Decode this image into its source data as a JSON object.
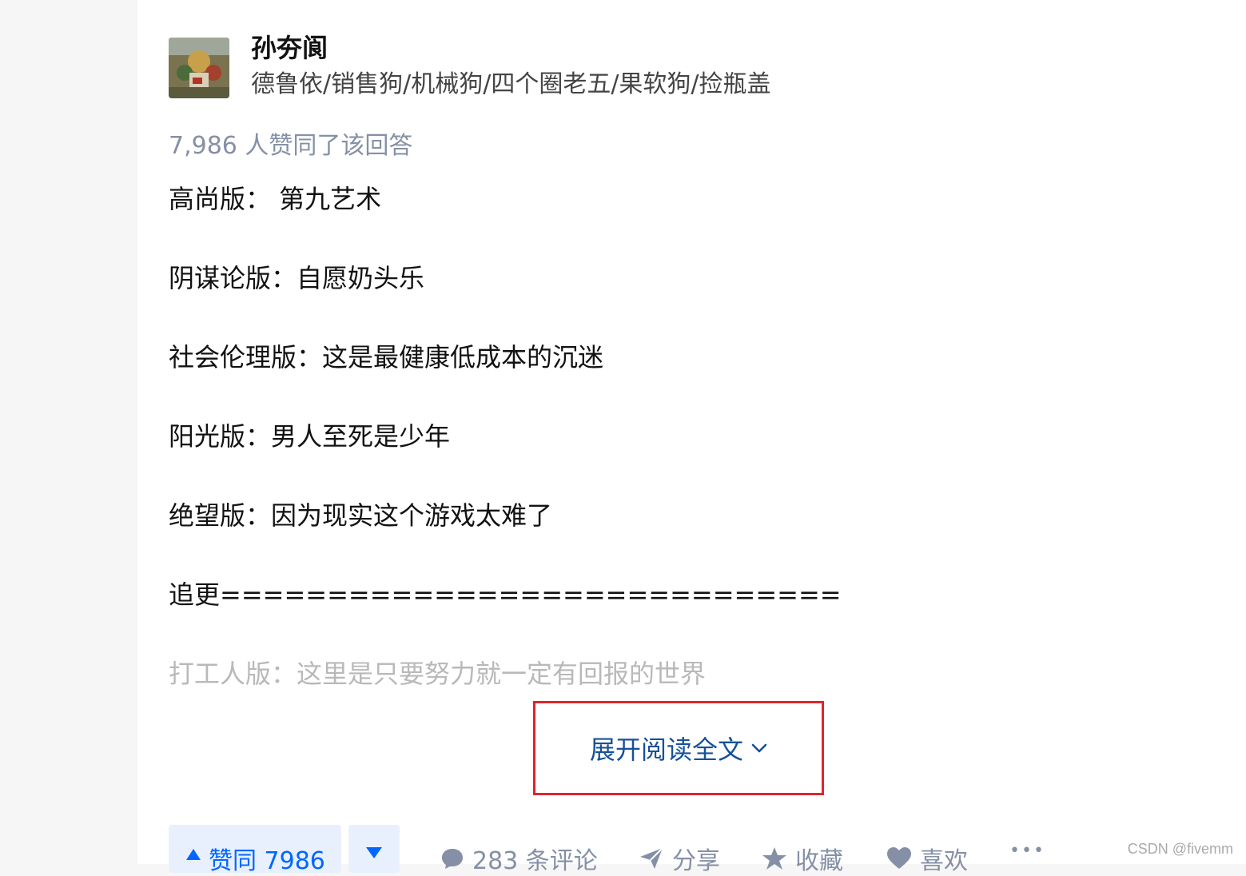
{
  "author": {
    "name": "孙夯阆",
    "bio": "德鲁依/销售狗/机械狗/四个圈老五/果软狗/捡瓶盖",
    "avatar_icon": "avatar-image"
  },
  "answer": {
    "votes_text": "7,986 人赞同了该回答",
    "paragraphs": [
      "高尚版： 第九艺术",
      "阴谋论版：自愿奶头乐",
      "社会伦理版：这是最健康低成本的沉迷",
      "阳光版：男人至死是少年",
      "绝望版：因为现实这个游戏太难了",
      "追更=============================",
      "打工人版：这里是只要努力就一定有回报的世界"
    ],
    "expand_label": "展开阅读全文"
  },
  "actions": {
    "upvote_label": "赞同 7986",
    "comments_label": "283 条评论",
    "share_label": "分享",
    "favorite_label": "收藏",
    "like_label": "喜欢",
    "more_label": "•••"
  },
  "watermark": "CSDN @fivemm",
  "colors": {
    "accent": "#0066ff",
    "link": "#175199",
    "highlight_border": "#e0242a",
    "meta": "#8590a6"
  }
}
